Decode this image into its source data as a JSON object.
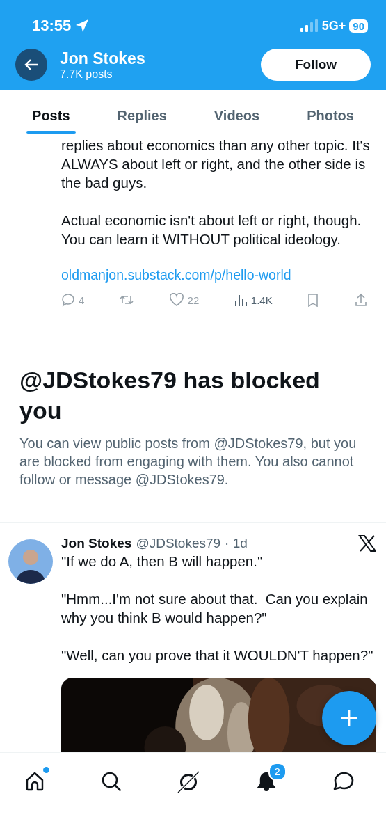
{
  "status_bar": {
    "time": "13:55",
    "network": "5G+",
    "battery": "90"
  },
  "header": {
    "name": "Jon Stokes",
    "posts_count": "7.7K posts",
    "follow_button": "Follow"
  },
  "tabs": [
    {
      "label": "Posts",
      "selected": true
    },
    {
      "label": "Replies",
      "selected": false
    },
    {
      "label": "Videos",
      "selected": false
    },
    {
      "label": "Photos",
      "selected": false
    }
  ],
  "top_post": {
    "paragraphs": [
      "replies about economics than any other topic. It's ALWAYS about left or right, and the other side is the bad guys.",
      "Actual economic isn't about left or right, though.  You can learn it WITHOUT political ideology."
    ],
    "link": "oldmanjon.substack.com/p/hello-world",
    "actions": [
      {
        "kind": "reply",
        "count": "4",
        "disabled": true
      },
      {
        "kind": "repost",
        "disabled": true
      },
      {
        "kind": "like",
        "count": "22",
        "disabled": true
      },
      {
        "kind": "views",
        "count": "1.4K",
        "disabled": false
      },
      {
        "kind": "bookmark",
        "disabled": true
      },
      {
        "kind": "share",
        "disabled": true
      }
    ]
  },
  "blocked_notice": {
    "title": "@JDStokes79 has blocked you",
    "text": "You can view public posts from @JDStokes79, but you are blocked from engaging with them. You also cannot follow or message @JDStokes79."
  },
  "post": {
    "name": "Jon Stokes",
    "handle": "@JDStokes79",
    "time": "· 1d",
    "paragraphs": [
      "\"If we do A, then B will happen.\"",
      "\"Hmm...I'm not sure about that.  Can you explain why you think B would happen?\"",
      "\"Well, can you prove that it WOULDN'T happen?\""
    ],
    "media": {
      "kind": "picture"
    }
  },
  "bottom_nav": [
    {
      "kind": "home",
      "selected": false,
      "dot": true
    },
    {
      "kind": "search",
      "selected": false
    },
    {
      "kind": "grok",
      "selected": false
    },
    {
      "kind": "notifications",
      "selected": true,
      "badge": "2"
    },
    {
      "kind": "messages",
      "selected": false
    }
  ]
}
